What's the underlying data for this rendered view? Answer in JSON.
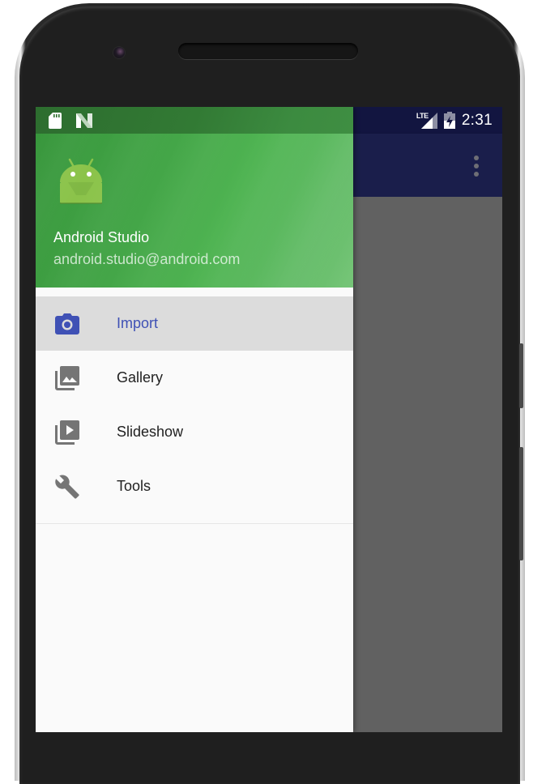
{
  "status_bar": {
    "left_icons": [
      "sd-card-icon",
      "android-n-icon"
    ],
    "network": "LTE",
    "battery_icon": "battery-charging-icon",
    "time": "2:31"
  },
  "toolbar": {
    "overflow_icon": "more-vert-icon"
  },
  "drawer": {
    "header": {
      "logo_icon": "android-logo-icon",
      "name": "Android Studio",
      "email": "android.studio@android.com"
    },
    "items": [
      {
        "label": "Import",
        "icon": "camera-icon",
        "selected": true
      },
      {
        "label": "Gallery",
        "icon": "photo-library-icon",
        "selected": false
      },
      {
        "label": "Slideshow",
        "icon": "slideshow-icon",
        "selected": false
      },
      {
        "label": "Tools",
        "icon": "wrench-icon",
        "selected": false
      }
    ]
  },
  "colors": {
    "accent": "#3f51b5",
    "header_green": "#4caf50",
    "toolbar": "#1a1e4b",
    "scrim": "#616161",
    "selected_bg": "#dcdcdc",
    "icon_gray": "#757575"
  }
}
